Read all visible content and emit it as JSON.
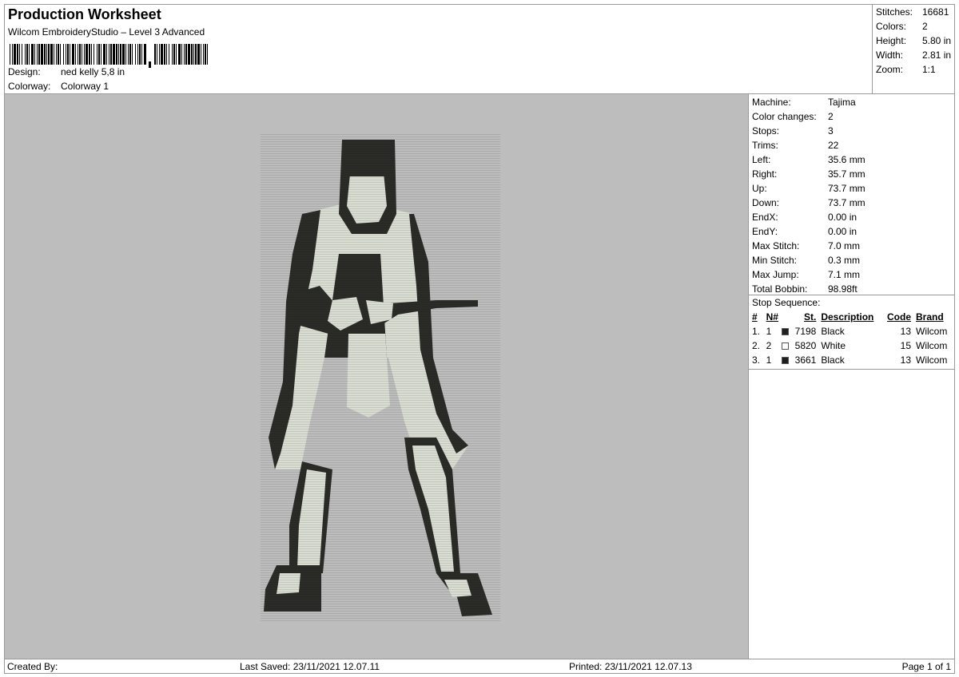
{
  "header": {
    "title": "Production Worksheet",
    "subtitle": "Wilcom EmbroideryStudio – Level 3 Advanced",
    "barcode_label": "design barcode",
    "design_label": "Design:",
    "design_value": "ned kelly 5,8 in",
    "colorway_label": "Colorway:",
    "colorway_value": "Colorway 1"
  },
  "summary": [
    {
      "label": "Stitches:",
      "value": "16681"
    },
    {
      "label": "Colors:",
      "value": "2"
    },
    {
      "label": "Height:",
      "value": "5.80 in"
    },
    {
      "label": "Width:",
      "value": "2.81 in"
    },
    {
      "label": "Zoom:",
      "value": "1:1"
    }
  ],
  "machine_info": [
    {
      "label": "Machine:",
      "value": "Tajima"
    },
    {
      "label": "Color changes:",
      "value": "2"
    },
    {
      "label": "Stops:",
      "value": "3"
    },
    {
      "label": "Trims:",
      "value": "22"
    },
    {
      "label": "Left:",
      "value": "35.6 mm"
    },
    {
      "label": "Right:",
      "value": "35.7 mm"
    },
    {
      "label": "Up:",
      "value": "73.7 mm"
    },
    {
      "label": "Down:",
      "value": "73.7 mm"
    },
    {
      "label": "EndX:",
      "value": "0.00 in"
    },
    {
      "label": "EndY:",
      "value": "0.00 in"
    },
    {
      "label": "Max Stitch:",
      "value": "7.0 mm"
    },
    {
      "label": "Min Stitch:",
      "value": "0.3 mm"
    },
    {
      "label": "Max Jump:",
      "value": "7.1 mm"
    },
    {
      "label": "Total Bobbin:",
      "value": "98.98ft"
    }
  ],
  "stop_sequence": {
    "title": "Stop Sequence:",
    "columns": {
      "idx": "#",
      "n": "N#",
      "st": "St.",
      "desc": "Description",
      "code": "Code",
      "brand": "Brand"
    },
    "rows": [
      {
        "idx": "1.",
        "n": "1",
        "color": "#1e1e1e",
        "st": "7198",
        "desc": "Black",
        "code": "13",
        "brand": "Wilcom"
      },
      {
        "idx": "2.",
        "n": "2",
        "color": "#ffffff",
        "st": "5820",
        "desc": "White",
        "code": "15",
        "brand": "Wilcom"
      },
      {
        "idx": "3.",
        "n": "1",
        "color": "#1e1e1e",
        "st": "3661",
        "desc": "Black",
        "code": "13",
        "brand": "Wilcom"
      }
    ]
  },
  "preview": {
    "background": "#bdbdbd",
    "thread_dark": "#2b2b27",
    "thread_light": "#d9ddd2"
  },
  "footer": {
    "created_by": "Created By:",
    "last_saved": "Last Saved: 23/11/2021 12.07.11",
    "printed": "Printed: 23/11/2021 12.07.13",
    "page": "Page 1 of 1"
  }
}
